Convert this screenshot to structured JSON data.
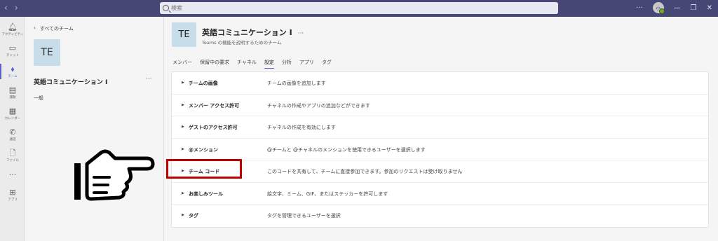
{
  "titlebar": {
    "search_placeholder": "検索",
    "more": "···",
    "avatar_initials": "小"
  },
  "rail": [
    {
      "label": "アクティビティ",
      "icon": "bell-icon"
    },
    {
      "label": "チャット",
      "icon": "chat-icon"
    },
    {
      "label": "チーム",
      "icon": "teams-icon"
    },
    {
      "label": "課題",
      "icon": "assignments-icon"
    },
    {
      "label": "カレンダー",
      "icon": "calendar-icon"
    },
    {
      "label": "通話",
      "icon": "phone-icon"
    },
    {
      "label": "ファイル",
      "icon": "file-icon"
    },
    {
      "label": "",
      "icon": "more-icon"
    },
    {
      "label": "アプリ",
      "icon": "apps-icon"
    }
  ],
  "panel": {
    "back_label": "すべてのチーム",
    "team_initials": "TE",
    "team_name": "英語コミュニケーション Ⅰ",
    "team_more": "···",
    "channel": "一般"
  },
  "main": {
    "initials": "TE",
    "title": "英語コミュニケーション Ⅰ",
    "more": "···",
    "subtitle": "Teams の機能を説明するためのチーム",
    "tabs": [
      "メンバー",
      "保留中の要求",
      "チャネル",
      "設定",
      "分析",
      "アプリ",
      "タグ"
    ],
    "active_tab": "設定"
  },
  "settings": [
    {
      "label": "チームの画像",
      "desc": "チームの画像を追加します"
    },
    {
      "label": "メンバー アクセス許可",
      "desc": "チャネルの作成やアプリの追加などができます"
    },
    {
      "label": "ゲストのアクセス許可",
      "desc": "チャネルの作成を有効にします"
    },
    {
      "label": "@メンション",
      "desc": "@チームと @チャネルのメンションを使用できるユーザーを選択します"
    },
    {
      "label": "チーム コード",
      "desc": "このコードを共有して、チームに直接参加できます。参加のリクエストは受け取りません"
    },
    {
      "label": "お楽しみツール",
      "desc": "絵文字、ミーム、GIF、またはステッカーを許可します"
    },
    {
      "label": "タグ",
      "desc": "タグを管理できるユーザーを選択"
    }
  ],
  "colors": {
    "titlebar": "#464775",
    "accent": "#5b5fc7",
    "highlight": "#c00000"
  }
}
